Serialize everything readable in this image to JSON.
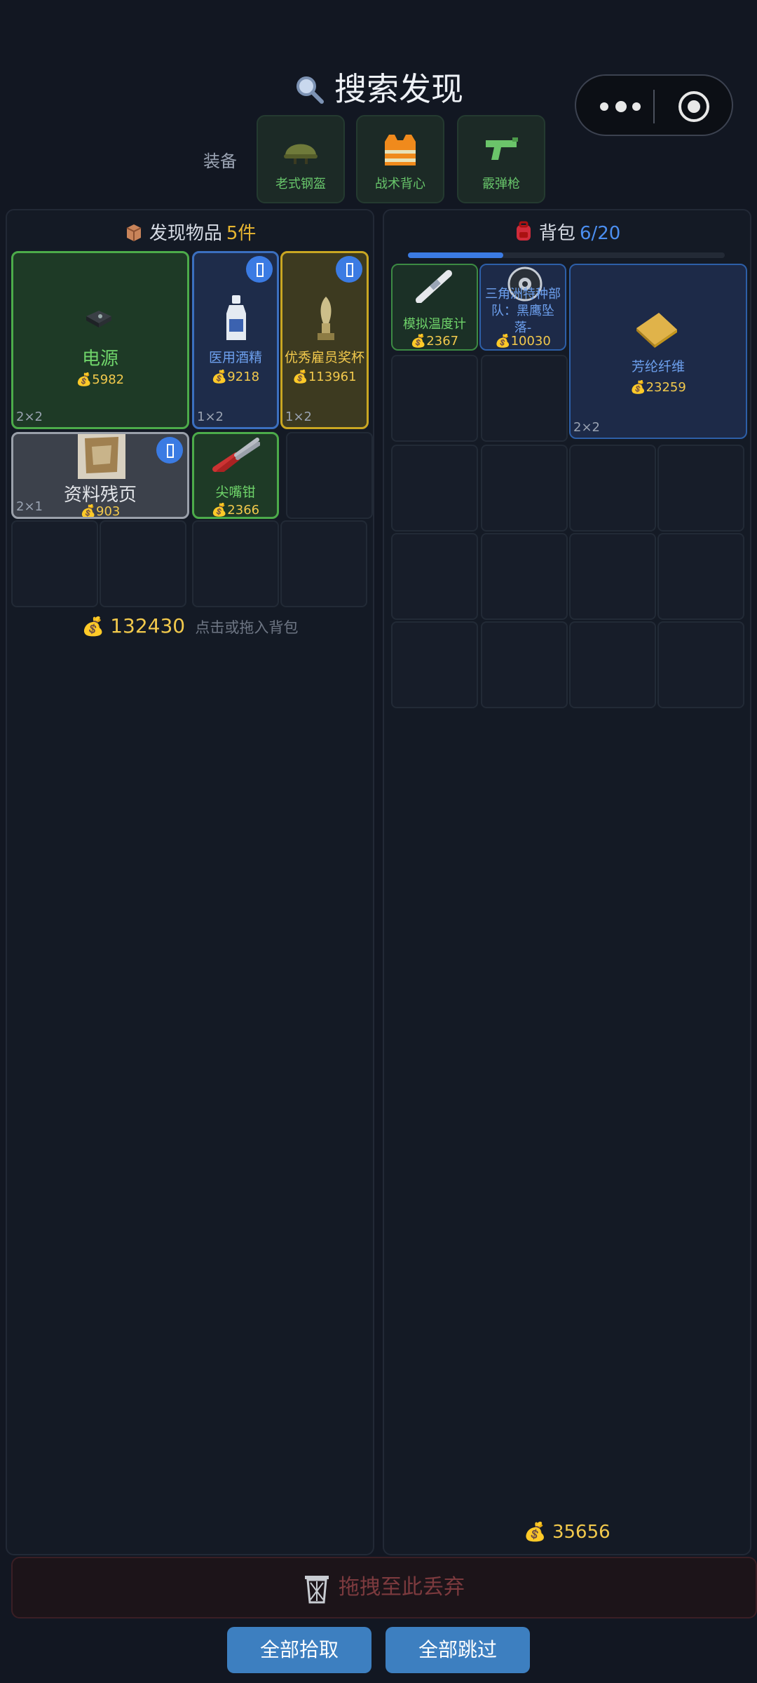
{
  "header": {
    "title": "搜索发现",
    "equip_label": "装备",
    "equipment": [
      {
        "label": "老式钢盔",
        "icon": "helmet-icon"
      },
      {
        "label": "战术背心",
        "icon": "vest-icon"
      },
      {
        "label": "霰弹枪",
        "icon": "shotgun-icon"
      }
    ]
  },
  "left_panel": {
    "title": "发现物品",
    "count": "5件",
    "items": [
      {
        "name": "电源",
        "price": "5982",
        "size": "2×2",
        "rarity": "green",
        "icon": "power-supply-icon"
      },
      {
        "name": "医用酒精",
        "price": "9218",
        "size": "1×2",
        "rarity": "blue",
        "icon": "alcohol-bottle-icon"
      },
      {
        "name": "优秀雇员奖杯",
        "price": "113961",
        "size": "1×2",
        "rarity": "gold",
        "icon": "trophy-icon"
      },
      {
        "name": "资料残页",
        "price": "903",
        "size": "2×1",
        "rarity": "gray",
        "icon": "document-scrap-icon"
      },
      {
        "name": "尖嘴钳",
        "price": "2366",
        "size": "",
        "rarity": "green",
        "icon": "pliers-icon"
      }
    ],
    "total": "132430",
    "hint": "点击或拖入背包"
  },
  "right_panel": {
    "title": "背包",
    "count": "6/20",
    "progress": 0.3,
    "items": [
      {
        "name": "模拟温度计",
        "price": "2367",
        "icon": "thermometer-icon"
      },
      {
        "name": "三角洲特种部队：黑鹰坠落-",
        "price": "10030",
        "icon": "disc-icon"
      },
      {
        "name": "芳纶纤维",
        "price": "23259",
        "size": "2×2",
        "icon": "fiber-icon"
      }
    ],
    "total": "35656"
  },
  "discard_label": "拖拽至此丢弃",
  "buttons": {
    "pick_all": "全部拾取",
    "skip_all": "全部跳过"
  },
  "colors": {
    "background": "#121722",
    "gold": "#f2c94c",
    "accent_blue": "#3b7be3",
    "button": "#3d7fc0"
  }
}
